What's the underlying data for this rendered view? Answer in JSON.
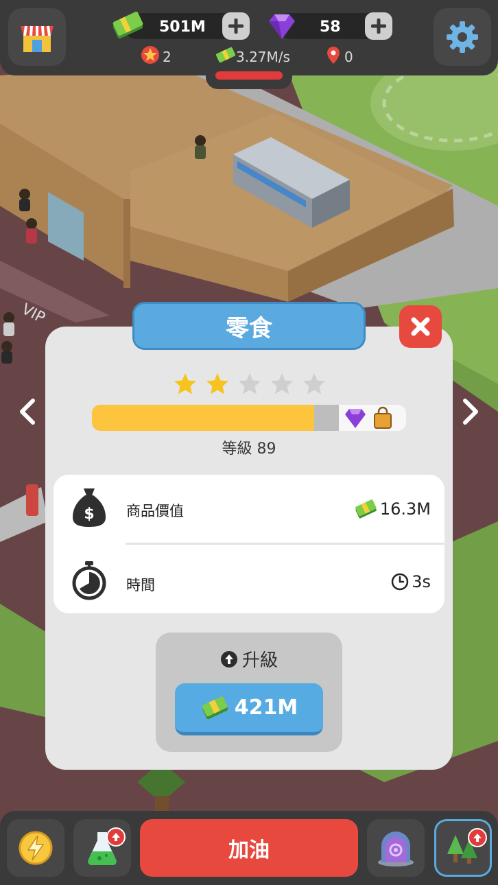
{
  "hud": {
    "cash": "501M",
    "gems": "58",
    "stars": "2",
    "income_rate": "3.27M/s",
    "locations": "0"
  },
  "modal": {
    "title": "零食",
    "stars_filled": 2,
    "stars_total": 5,
    "progress_fraction": 0.7,
    "level_text": "等級 89",
    "rows": [
      {
        "label": "商品價值",
        "value": "16.3M",
        "icon": "money-bag-icon",
        "value_icon": "cash-icon"
      },
      {
        "label": "時間",
        "value": "3s",
        "icon": "stopwatch-icon",
        "value_icon": "clock-icon"
      }
    ],
    "upgrade_title": "升級",
    "upgrade_cost": "421M"
  },
  "bottom": {
    "refuel_label": "加油"
  },
  "colors": {
    "accent_blue": "#56abe3",
    "close_red": "#e8493f",
    "progress_yellow": "#fdc43e",
    "gem_purple": "#8a3fd8"
  }
}
